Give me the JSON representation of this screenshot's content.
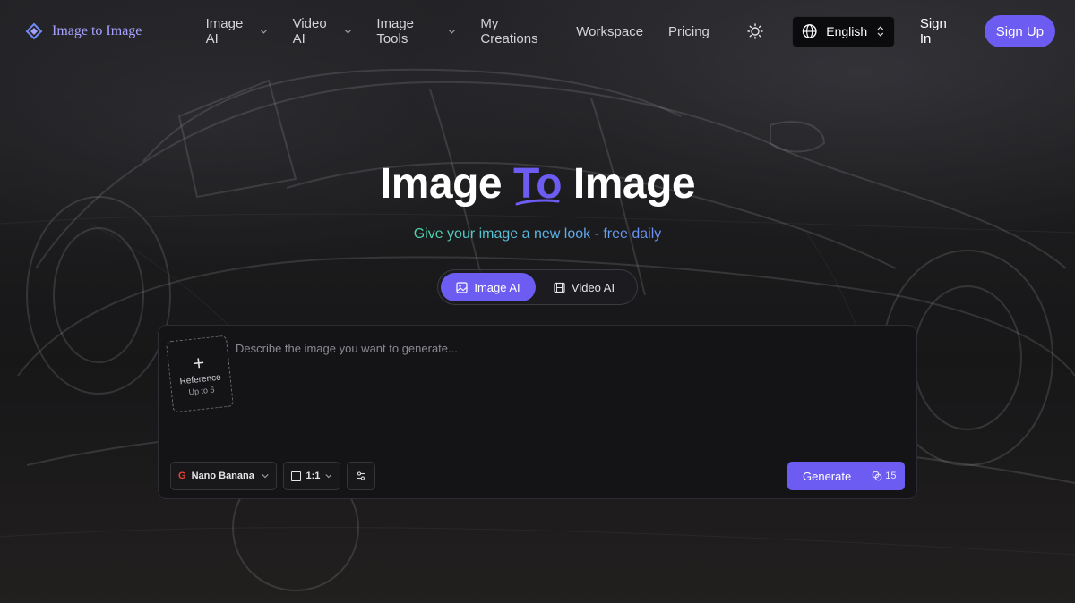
{
  "nav": {
    "logo_text": "Image to Image",
    "menu": [
      {
        "label": "Image AI",
        "has_dropdown": true
      },
      {
        "label": "Video AI",
        "has_dropdown": true
      },
      {
        "label": "Image Tools",
        "has_dropdown": true
      },
      {
        "label": "My Creations",
        "has_dropdown": false
      },
      {
        "label": "Workspace",
        "has_dropdown": false
      },
      {
        "label": "Pricing",
        "has_dropdown": false
      }
    ],
    "theme_icon": "sun-icon",
    "language": "English",
    "sign_in": "Sign In",
    "sign_up": "Sign Up"
  },
  "hero": {
    "title_part1": "Image ",
    "title_accent": "To",
    "title_part2": " Image",
    "subtitle": "Give your image a new look - free daily"
  },
  "mode_toggle": {
    "options": [
      {
        "label": "Image AI",
        "icon": "image-icon",
        "active": true
      },
      {
        "label": "Video AI",
        "icon": "film-icon",
        "active": false
      }
    ]
  },
  "prompt_box": {
    "reference_label": "Reference",
    "reference_limit": "Up to 6",
    "placeholder": "Describe the image you want to generate...",
    "model": {
      "badge": "G",
      "label": "Nano Banana"
    },
    "aspect_ratio": "1:1",
    "generate_label": "Generate",
    "credit_cost": "15"
  },
  "colors": {
    "accent": "#6d5cf2",
    "logo_text": "#a8a2ff",
    "background": "#1a1a1c"
  }
}
